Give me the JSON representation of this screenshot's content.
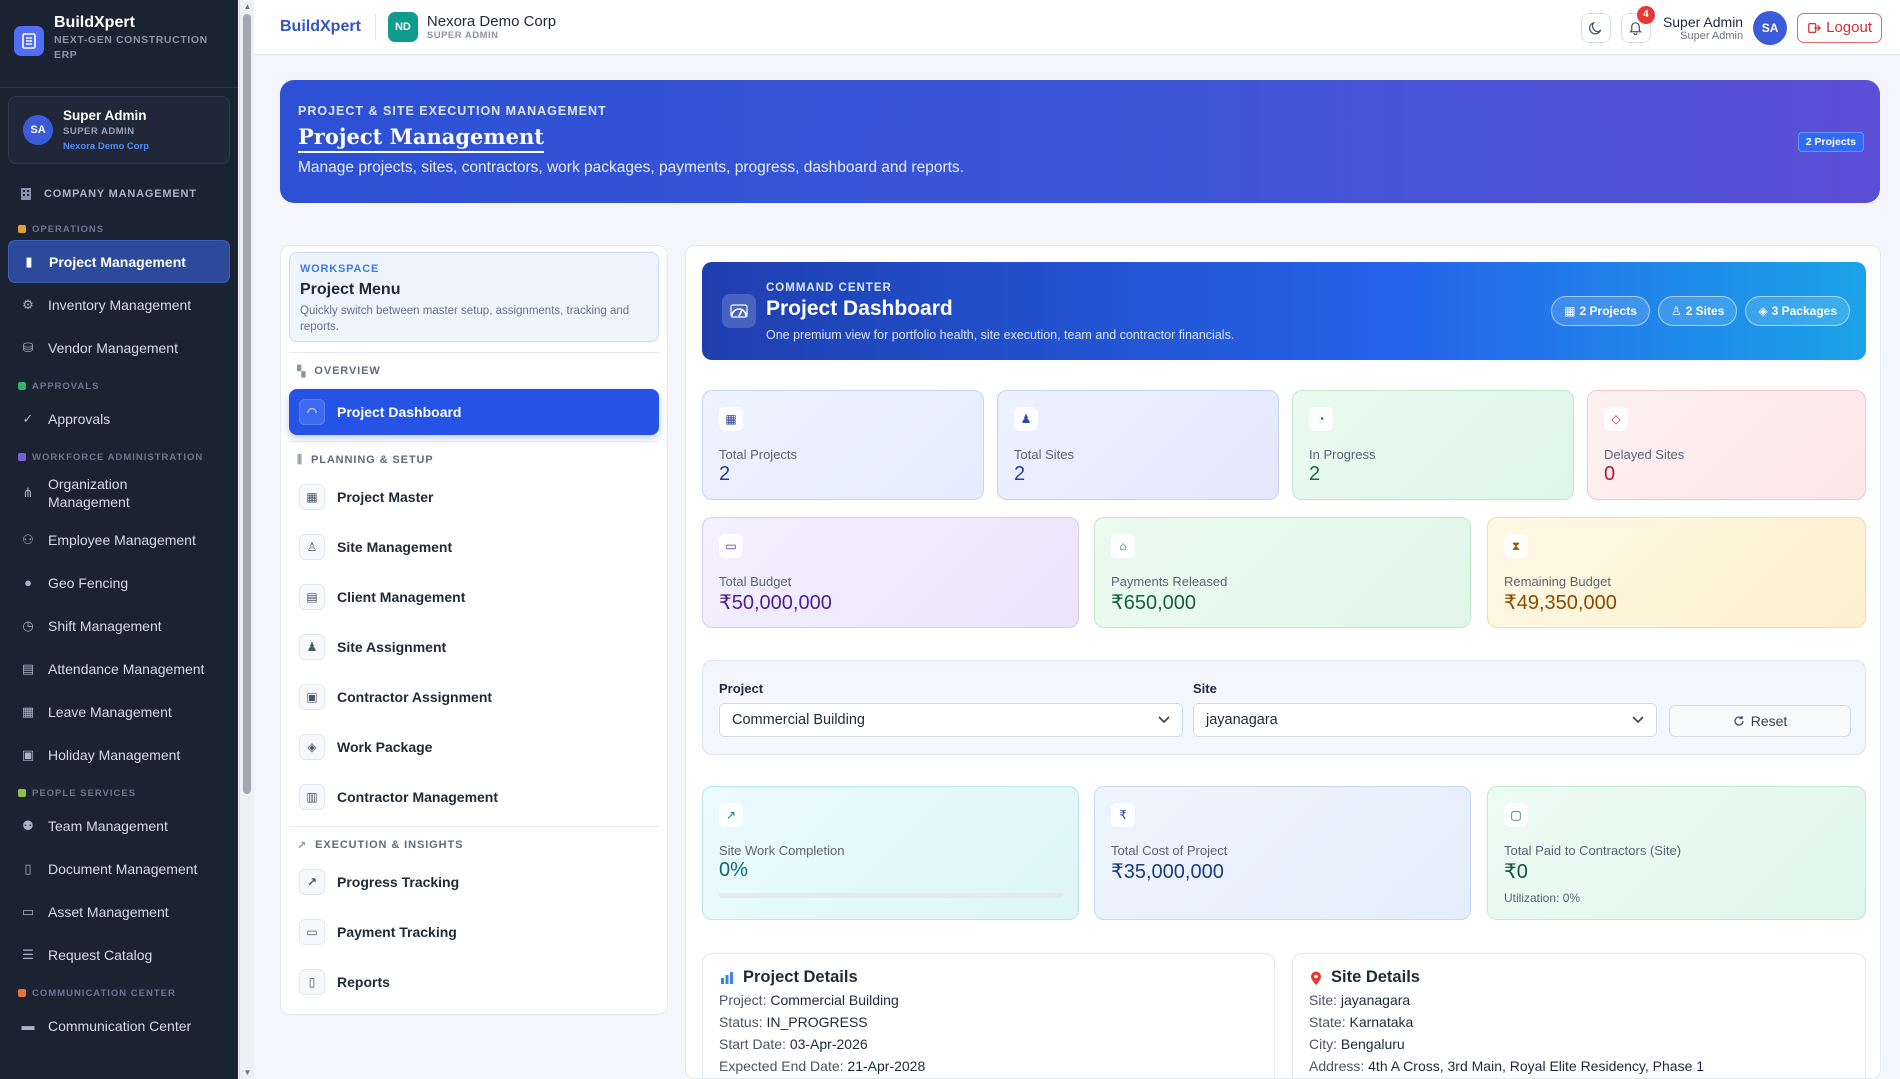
{
  "sidebar": {
    "brand_name": "BuildXpert",
    "brand_tagline": "NEXT-GEN CONSTRUCTION ERP",
    "user": {
      "initials": "SA",
      "name": "Super Admin",
      "role": "SUPER ADMIN",
      "org": "Nexora Demo Corp"
    },
    "top_link": "COMPANY MANAGEMENT",
    "sections": [
      {
        "title": "OPERATIONS",
        "color": "#e0a32e",
        "items": [
          {
            "label": "Project Management",
            "icon": "chart-bar-icon",
            "active": true
          },
          {
            "label": "Inventory Management",
            "icon": "boxes-icon"
          },
          {
            "label": "Vendor Management",
            "icon": "vendor-icon"
          }
        ]
      },
      {
        "title": "APPROVALS",
        "color": "#2fb36a",
        "items": [
          {
            "label": "Approvals",
            "icon": "check-circle-icon"
          }
        ]
      },
      {
        "title": "WORKFORCE ADMINISTRATION",
        "color": "#7b5cd6",
        "items": [
          {
            "label": "Organization Management",
            "icon": "org-chart-icon"
          },
          {
            "label": "Employee Management",
            "icon": "users-icon"
          },
          {
            "label": "Geo Fencing",
            "icon": "map-pin-icon"
          },
          {
            "label": "Shift Management",
            "icon": "clock-icon"
          },
          {
            "label": "Attendance Management",
            "icon": "calendar-chart-icon"
          },
          {
            "label": "Leave Management",
            "icon": "calendar-icon"
          },
          {
            "label": "Holiday Management",
            "icon": "calendar-star-icon"
          }
        ]
      },
      {
        "title": "PEOPLE SERVICES",
        "color": "#8bc34a",
        "items": [
          {
            "label": "Team Management",
            "icon": "team-icon"
          },
          {
            "label": "Document Management",
            "icon": "document-icon"
          },
          {
            "label": "Asset Management",
            "icon": "laptop-icon"
          },
          {
            "label": "Request Catalog",
            "icon": "list-icon"
          }
        ]
      },
      {
        "title": "COMMUNICATION CENTER",
        "color": "#e5753b",
        "items": [
          {
            "label": "Communication Center",
            "icon": "chat-icon"
          }
        ]
      }
    ]
  },
  "header": {
    "brand": "BuildXpert",
    "org_initials": "ND",
    "org_name": "Nexora Demo Corp",
    "org_role": "SUPER ADMIN",
    "notifications_count": "4",
    "user_name": "Super Admin",
    "user_role": "Super Admin",
    "user_initials": "SA",
    "logout_label": "Logout"
  },
  "hero": {
    "kicker": "PROJECT & SITE EXECUTION MANAGEMENT",
    "title": "Project Management",
    "description": "Manage projects, sites, contractors, work packages, payments, progress, dashboard and reports.",
    "pill": "2 Projects"
  },
  "menu": {
    "workspace_kicker": "WORKSPACE",
    "workspace_title": "Project Menu",
    "workspace_desc": "Quickly switch between master setup, assignments, tracking and reports.",
    "sections": [
      {
        "title": "OVERVIEW",
        "items": [
          {
            "label": "Project Dashboard",
            "icon": "dashboard-icon",
            "active": true
          }
        ]
      },
      {
        "title": "PLANNING & SETUP",
        "items": [
          {
            "label": "Project Master",
            "icon": "building-icon"
          },
          {
            "label": "Site Management",
            "icon": "user-icon"
          },
          {
            "label": "Client Management",
            "icon": "id-card-icon"
          },
          {
            "label": "Site Assignment",
            "icon": "user-check-icon"
          },
          {
            "label": "Contractor Assignment",
            "icon": "badge-icon"
          },
          {
            "label": "Work Package",
            "icon": "package-icon"
          },
          {
            "label": "Contractor Management",
            "icon": "building-2-icon"
          }
        ]
      },
      {
        "title": "EXECUTION & INSIGHTS",
        "items": [
          {
            "label": "Progress Tracking",
            "icon": "trend-icon"
          },
          {
            "label": "Payment Tracking",
            "icon": "money-icon"
          },
          {
            "label": "Reports",
            "icon": "report-icon"
          }
        ]
      }
    ]
  },
  "dashboard": {
    "kicker": "COMMAND CENTER",
    "title": "Project Dashboard",
    "description": "One premium view for portfolio health, site execution, team and contractor financials.",
    "pills": [
      "2 Projects",
      "2 Sites",
      "3 Packages"
    ],
    "stats_row1": [
      {
        "label": "Total Projects",
        "value": "2",
        "icon": "building-icon"
      },
      {
        "label": "Total Sites",
        "value": "2",
        "icon": "user-icon"
      },
      {
        "label": "In Progress",
        "value": "2",
        "icon": "progress-icon"
      },
      {
        "label": "Delayed Sites",
        "value": "0",
        "icon": "warning-diamond-icon"
      }
    ],
    "stats_row2": [
      {
        "label": "Total Budget",
        "value": "₹50,000,000",
        "icon": "money-icon"
      },
      {
        "label": "Payments Released",
        "value": "₹650,000",
        "icon": "bank-icon"
      },
      {
        "label": "Remaining Budget",
        "value": "₹49,350,000",
        "icon": "hourglass-icon"
      }
    ],
    "filters": {
      "project_label": "Project",
      "project_value": "Commercial Building",
      "site_label": "Site",
      "site_value": "jayanagara",
      "reset_label": "Reset"
    },
    "site_stats": [
      {
        "label": "Site Work Completion",
        "value": "0%",
        "progress": 0,
        "icon": "trend-icon"
      },
      {
        "label": "Total Cost of Project",
        "value": "₹35,000,000",
        "icon": "rupee-icon"
      },
      {
        "label": "Total Paid to Contractors (Site)",
        "value": "₹0",
        "extra": "Utilization: 0%",
        "icon": "wallet-icon"
      }
    ],
    "project_details": {
      "title": "Project Details",
      "rows": [
        {
          "k": "Project:",
          "v": "Commercial Building"
        },
        {
          "k": "Status:",
          "v": "IN_PROGRESS"
        },
        {
          "k": "Start Date:",
          "v": "03-Apr-2026"
        },
        {
          "k": "Expected End Date:",
          "v": "21-Apr-2028"
        }
      ]
    },
    "site_details": {
      "title": "Site Details",
      "rows": [
        {
          "k": "Site:",
          "v": "jayanagara"
        },
        {
          "k": "State:",
          "v": "Karnataka"
        },
        {
          "k": "City:",
          "v": "Bengaluru"
        },
        {
          "k": "Address:",
          "v": "4th A Cross, 3rd Main, Royal Elite Residency, Phase 1"
        }
      ]
    }
  }
}
